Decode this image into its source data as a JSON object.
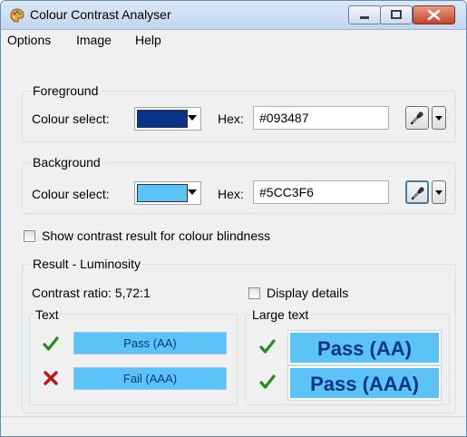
{
  "window": {
    "title": "Colour Contrast Analyser"
  },
  "menu": {
    "options": "Options",
    "image": "Image",
    "help": "Help"
  },
  "foreground": {
    "group_label": "Foreground",
    "colour_select_label": "Colour select:",
    "colour": "#093487",
    "hex_label": "Hex:",
    "hex_value": "#093487"
  },
  "background": {
    "group_label": "Background",
    "colour_select_label": "Colour select:",
    "colour": "#5CC3F6",
    "hex_label": "Hex:",
    "hex_value": "#5CC3F6"
  },
  "colour_blindness": {
    "label": "Show contrast result for colour blindness",
    "checked": false
  },
  "result": {
    "group_label": "Result - Luminosity",
    "contrast_ratio": "Contrast ratio: 5,72:1",
    "display_details_label": "Display details",
    "display_details_checked": false,
    "text": {
      "label": "Text",
      "aa": {
        "status": "pass",
        "label": "Pass (AA)"
      },
      "aaa": {
        "status": "fail",
        "label": "Fail (AAA)"
      }
    },
    "large_text": {
      "label": "Large text",
      "aa": {
        "status": "pass",
        "label": "Pass (AA)"
      },
      "aaa": {
        "status": "pass",
        "label": "Pass (AAA)"
      }
    }
  },
  "icons": {
    "app": "palette-icon",
    "pass": "checkmark-icon",
    "fail": "cross-icon",
    "picker": "eyedropper-icon"
  }
}
